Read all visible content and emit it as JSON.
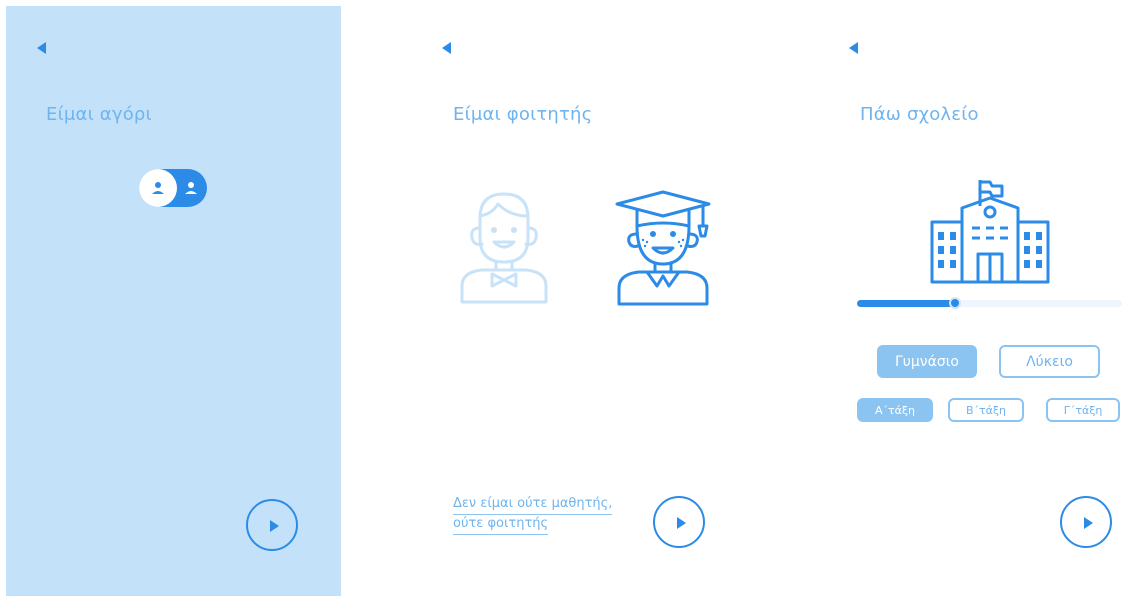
{
  "colors": {
    "accent": "#2b8be6",
    "light_accent": "#8cc4f1",
    "panel_bg": "#c3e1f8",
    "title": "#6fb4ef"
  },
  "screen1": {
    "back_icon": "back-arrow-icon",
    "title": "Είμαι αγόρι",
    "toggle_left_icon": "person-icon",
    "toggle_right_icon": "person-icon",
    "next_icon": "play-icon"
  },
  "screen2": {
    "back_icon": "back-arrow-icon",
    "title": "Είμαι φοιτητής",
    "option_student_icon": "boy-icon",
    "option_graduate_icon": "graduate-icon",
    "link_line1": "Δεν είμαι ούτε μαθητής,",
    "link_line2": "ούτε φοιτητής",
    "next_icon": "play-icon"
  },
  "screen3": {
    "back_icon": "back-arrow-icon",
    "title": "Πάω σχολείο",
    "school_icon": "school-building-icon",
    "progress_fraction": 0.37,
    "school_options": [
      "Γυμνάσιο",
      "Λύκειο"
    ],
    "selected_school": "Γυμνάσιο",
    "grade_options": [
      "Α΄τάξη",
      "Β΄τάξη",
      "Γ΄τάξη"
    ],
    "selected_grade": "Α΄τάξη",
    "next_icon": "play-icon"
  }
}
